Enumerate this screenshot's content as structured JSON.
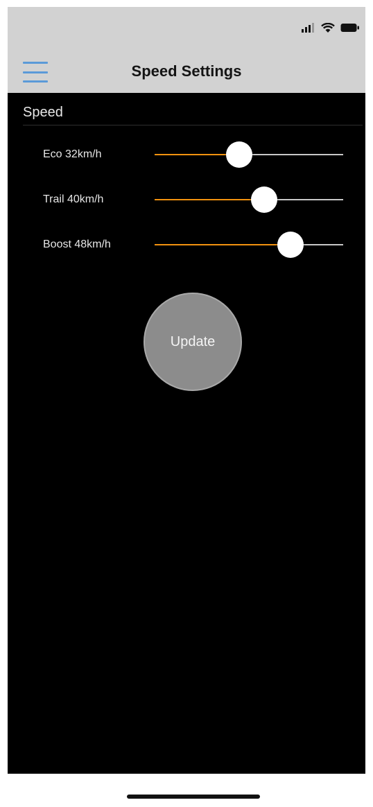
{
  "nav": {
    "title": "Speed Settings"
  },
  "section": {
    "header": "Speed"
  },
  "speeds": [
    {
      "label": "Eco 32km/h",
      "value": 0.45
    },
    {
      "label": "Trail 40km/h",
      "value": 0.58
    },
    {
      "label": "Boost 48km/h",
      "value": 0.72
    }
  ],
  "update_button": {
    "label": "Update"
  },
  "colors": {
    "accent": "#f2920f",
    "menu_icon": "#5b9ad8",
    "nav_background": "#d2d2d2",
    "content_background": "#000000",
    "button_background": "#8c8c8c"
  },
  "icons": {
    "menu": "hamburger-menu-icon",
    "signal": "cellular-signal-icon",
    "wifi": "wifi-icon",
    "battery": "battery-icon"
  }
}
